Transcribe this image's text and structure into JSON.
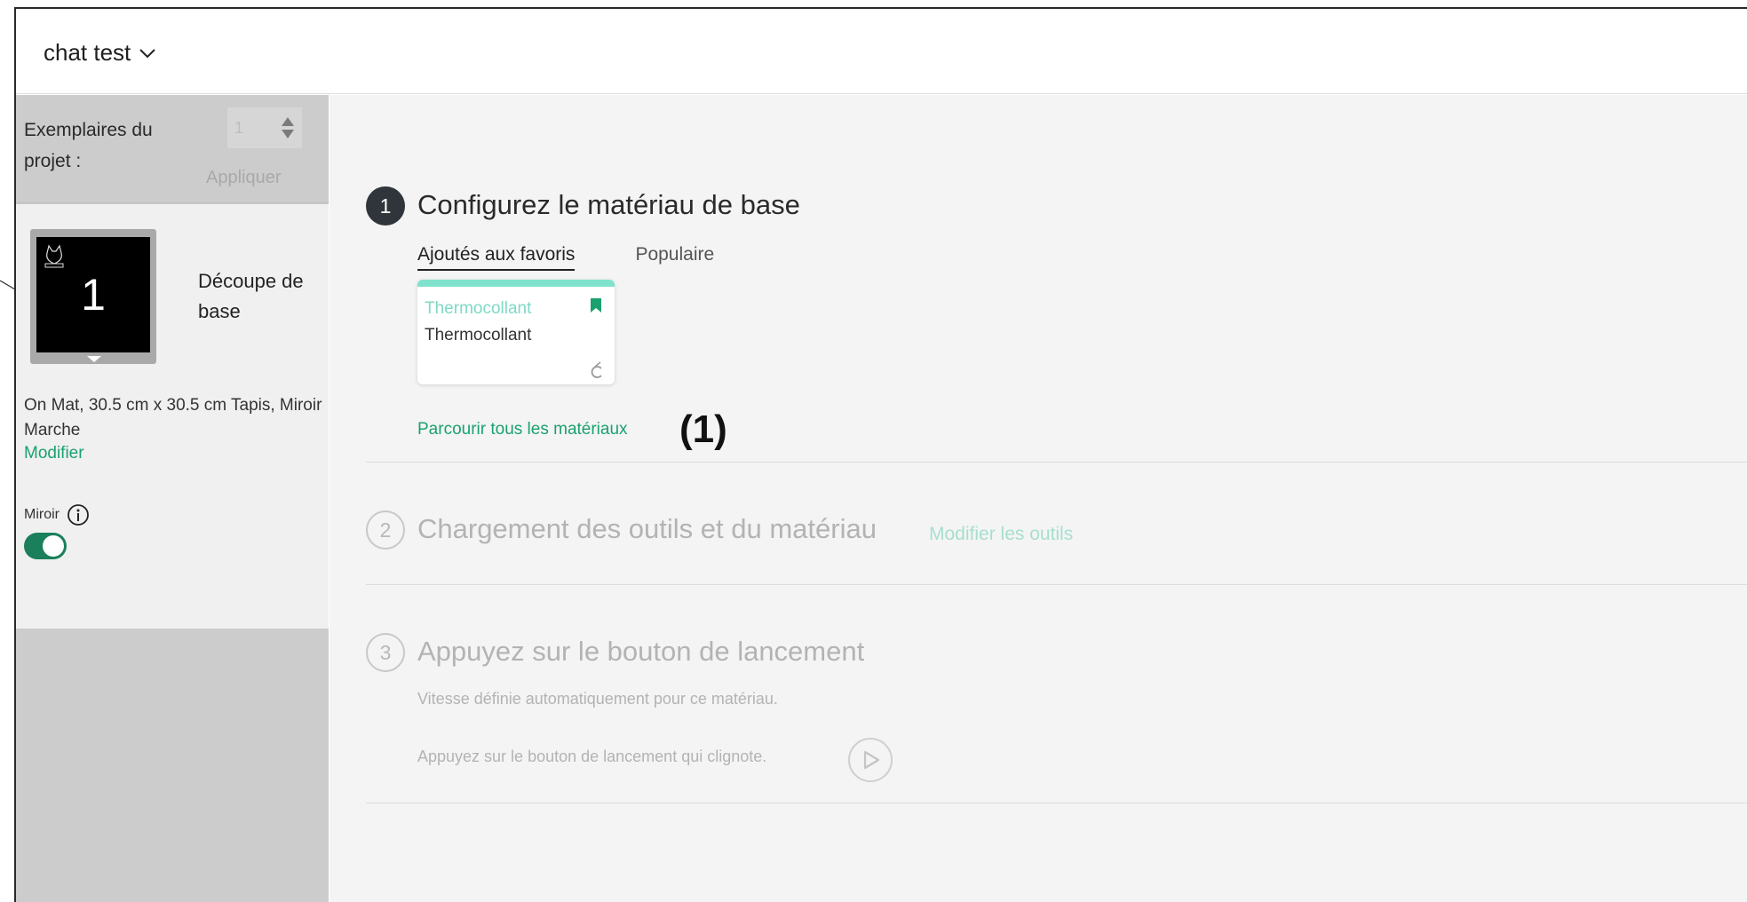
{
  "header": {
    "project_title": "chat test"
  },
  "sidebar": {
    "copies_label": "Exemplaires du projet :",
    "copies_value": "1",
    "apply_label": "Appliquer",
    "mat": {
      "number": "1",
      "name": "Découpe de base",
      "info": "On Mat, 30.5 cm x 30.5 cm Tapis, Miroir Marche",
      "modify_label": "Modifier",
      "mirror_label": "Miroir",
      "mirror_on": true
    }
  },
  "main": {
    "step1": {
      "number": "1",
      "title": "Configurez le matériau de base",
      "tabs": [
        "Ajoutés aux favoris",
        "Populaire"
      ],
      "material_card": {
        "title": "Thermocollant",
        "subtitle": "Thermocollant"
      },
      "browse_label": "Parcourir tous les matériaux",
      "callout": "(1)"
    },
    "step2": {
      "number": "2",
      "title": "Chargement des outils et du matériau",
      "edit_tools_label": "Modifier les outils"
    },
    "step3": {
      "number": "3",
      "title": "Appuyez sur le bouton de lancement",
      "speed_text": "Vitesse définie automatiquement pour ce matériau.",
      "press_text": "Appuyez sur le bouton de lancement qui clignote."
    }
  },
  "colors": {
    "accent_green": "#1aa170",
    "toggle_green": "#1a7f5a",
    "card_teal": "#7ee2cc",
    "sidebar_gray": "#cccccc"
  }
}
